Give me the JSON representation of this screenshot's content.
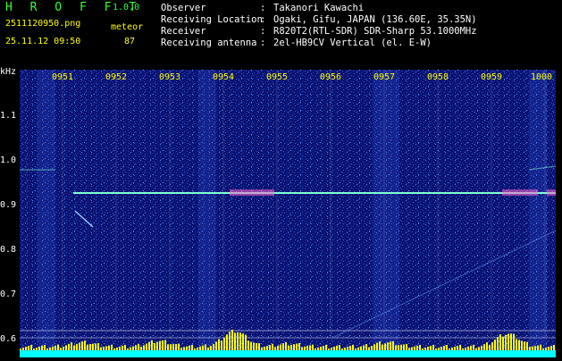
{
  "header": {
    "app_name": "H R O F F T",
    "version": "1.0.0",
    "file_name": "2511120950.png",
    "meteor_label": "meteor",
    "datetime": "25.11.12 09:50",
    "meteor_count": "87",
    "info": [
      {
        "key": "Observer",
        "value": "Takanori Kawachi"
      },
      {
        "key": "Receiving Location",
        "value": "Ogaki, Gifu, JAPAN (136.60E, 35.35N)"
      },
      {
        "key": "Receiver",
        "value": "R820T2(RTL-SDR) SDR-Sharp 53.1000MHz"
      },
      {
        "key": "Receiving antenna",
        "value": "2el-HB9CV Vertical (el. E-W)"
      }
    ],
    "colon": ":"
  },
  "axis": {
    "unit": "kHz",
    "y_ticks": [
      "1.1",
      "1.0",
      "0.9",
      "0.8",
      "0.7",
      "0.6"
    ],
    "x_ticks": [
      "0951",
      "0952",
      "0953",
      "0954",
      "0955",
      "0956",
      "0957",
      "0958",
      "0959",
      "1000"
    ]
  },
  "colors": {
    "background": "#000000",
    "spectrogram_base": "#0a0f6a",
    "carrier_line": "#7fffd4",
    "grid": "#ffffff",
    "bar_fill": "#ffff00",
    "bar_base": "#00ffff"
  }
}
